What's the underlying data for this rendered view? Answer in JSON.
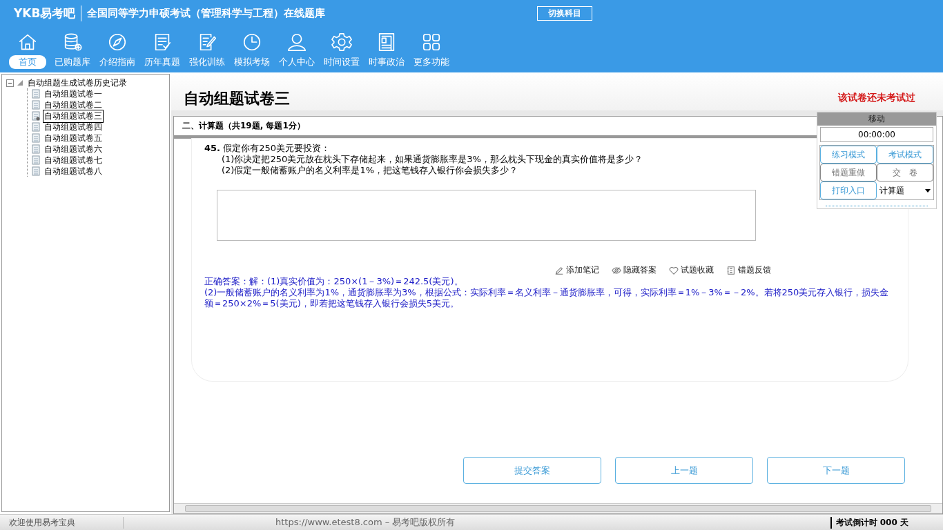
{
  "header": {
    "logo": "YKB易考吧",
    "title": "全国同等学力申硕考试（管理科学与工程）在线题库",
    "switch_button": "切换科目"
  },
  "nav": [
    {
      "label": "首页",
      "selected": true
    },
    {
      "label": "已购题库",
      "selected": false
    },
    {
      "label": "介绍指南",
      "selected": false
    },
    {
      "label": "历年真题",
      "selected": false
    },
    {
      "label": "强化训练",
      "selected": false
    },
    {
      "label": "模拟考场",
      "selected": false
    },
    {
      "label": "个人中心",
      "selected": false
    },
    {
      "label": "时间设置",
      "selected": false
    },
    {
      "label": "时事政治",
      "selected": false
    },
    {
      "label": "更多功能",
      "selected": false
    }
  ],
  "tree": {
    "label": "自动组题生成试卷历史记录",
    "expanded": true,
    "children": [
      {
        "label": "自动组题试卷一",
        "selected": false
      },
      {
        "label": "自动组题试卷二",
        "selected": false
      },
      {
        "label": "自动组题试卷三",
        "selected": true
      },
      {
        "label": "自动组题试卷四",
        "selected": false
      },
      {
        "label": "自动组题试卷五",
        "selected": false
      },
      {
        "label": "自动组题试卷六",
        "selected": false
      },
      {
        "label": "自动组题试卷七",
        "selected": false
      },
      {
        "label": "自动组题试卷八",
        "selected": false
      }
    ]
  },
  "paper": {
    "title": "自动组题试卷三",
    "status": "该试卷还未考试过",
    "section": "二、计算题（共19题, 每题1分）"
  },
  "question": {
    "number": "45.",
    "stem": "假定你有250美元要投资：",
    "parts": [
      "(1)你决定把250美元放在枕头下存储起来，如果通货膨胀率是3%，那么枕头下现金的真实价值将是多少？",
      "(2)假定一般储蓄账户的名义利率是1%，把这笔钱存入银行你会损失多少？"
    ]
  },
  "actions": [
    "添加笔记",
    "隐藏答案",
    "试题收藏",
    "错题反馈"
  ],
  "answer": [
    "正确答案：解：(1)真实价值为：250×(1－3%)＝242.5(美元)。",
    "(2)一般储蓄账户的名义利率为1%，通货膨胀率为3%，根据公式：实际利率＝名义利率－通货膨胀率，可得，实际利率＝1%－3%＝－2%。若将250美元存入银行，损失金额＝250×2%＝5(美元)，即若把这笔钱存入银行会损失5美元。"
  ],
  "nav_buttons": [
    "提交答案",
    "上一题",
    "下一题"
  ],
  "side_panel": {
    "header": "移动",
    "timer": "00:00:00",
    "buttons": [
      {
        "label": "练习模式",
        "disabled": false
      },
      {
        "label": "考试模式",
        "disabled": false
      },
      {
        "label": "错题重做",
        "disabled": true
      },
      {
        "label": "交　卷",
        "disabled": true
      },
      {
        "label": "打印入口",
        "disabled": false
      }
    ],
    "type_select": "计算题"
  },
  "status_bar": {
    "welcome": "欢迎使用易考宝典",
    "copyright": "https://www.etest8.com – 易考吧版权所有",
    "countdown": "考试倒计时 000 天"
  }
}
